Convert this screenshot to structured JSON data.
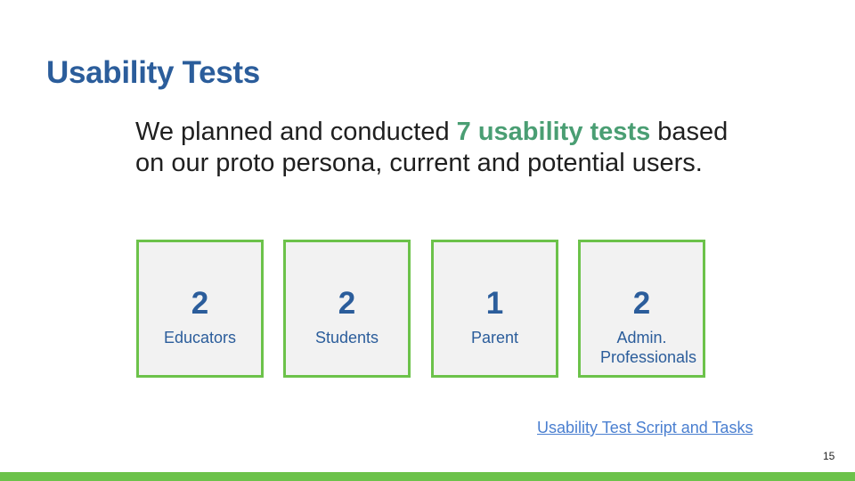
{
  "slide": {
    "title": "Usability Tests",
    "intro_before": "We planned and conducted ",
    "intro_highlight": "7 usability tests",
    "intro_after": " based on our proto persona, current and potential users.",
    "cards": [
      {
        "number": "2",
        "label": "Educators"
      },
      {
        "number": "2",
        "label": "Students"
      },
      {
        "number": "1",
        "label": "Parent"
      },
      {
        "number": "2",
        "label": "Admin. Professionals"
      }
    ],
    "link_text": "Usability Test Script and Tasks",
    "page_number": "15"
  },
  "colors": {
    "title": "#2b5d9b",
    "highlight": "#4a9e73",
    "card_border": "#6cc24a",
    "card_background": "#f2f2f2",
    "link": "#4a7fd0",
    "footer_bar": "#6cc24a"
  }
}
